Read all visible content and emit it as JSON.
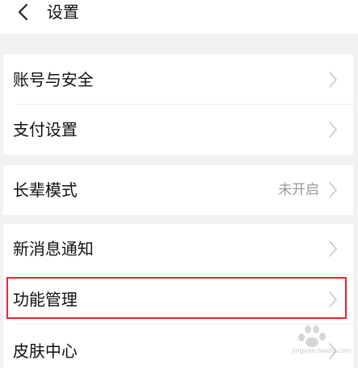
{
  "header": {
    "title": "设置"
  },
  "rows": [
    {
      "label": "账号与安全",
      "value": ""
    },
    {
      "label": "支付设置",
      "value": ""
    },
    {
      "label": "长辈模式",
      "value": "未开启"
    },
    {
      "label": "新消息通知",
      "value": ""
    },
    {
      "label": "功能管理",
      "value": ""
    },
    {
      "label": "皮肤中心",
      "value": ""
    }
  ],
  "watermark": {
    "text": "jingyan.baidu.com"
  },
  "colors": {
    "highlight": "#e8262a",
    "background": "#f2f2f2",
    "chevron": "#c7c7c7",
    "secondary_text": "#9a9a9a"
  }
}
